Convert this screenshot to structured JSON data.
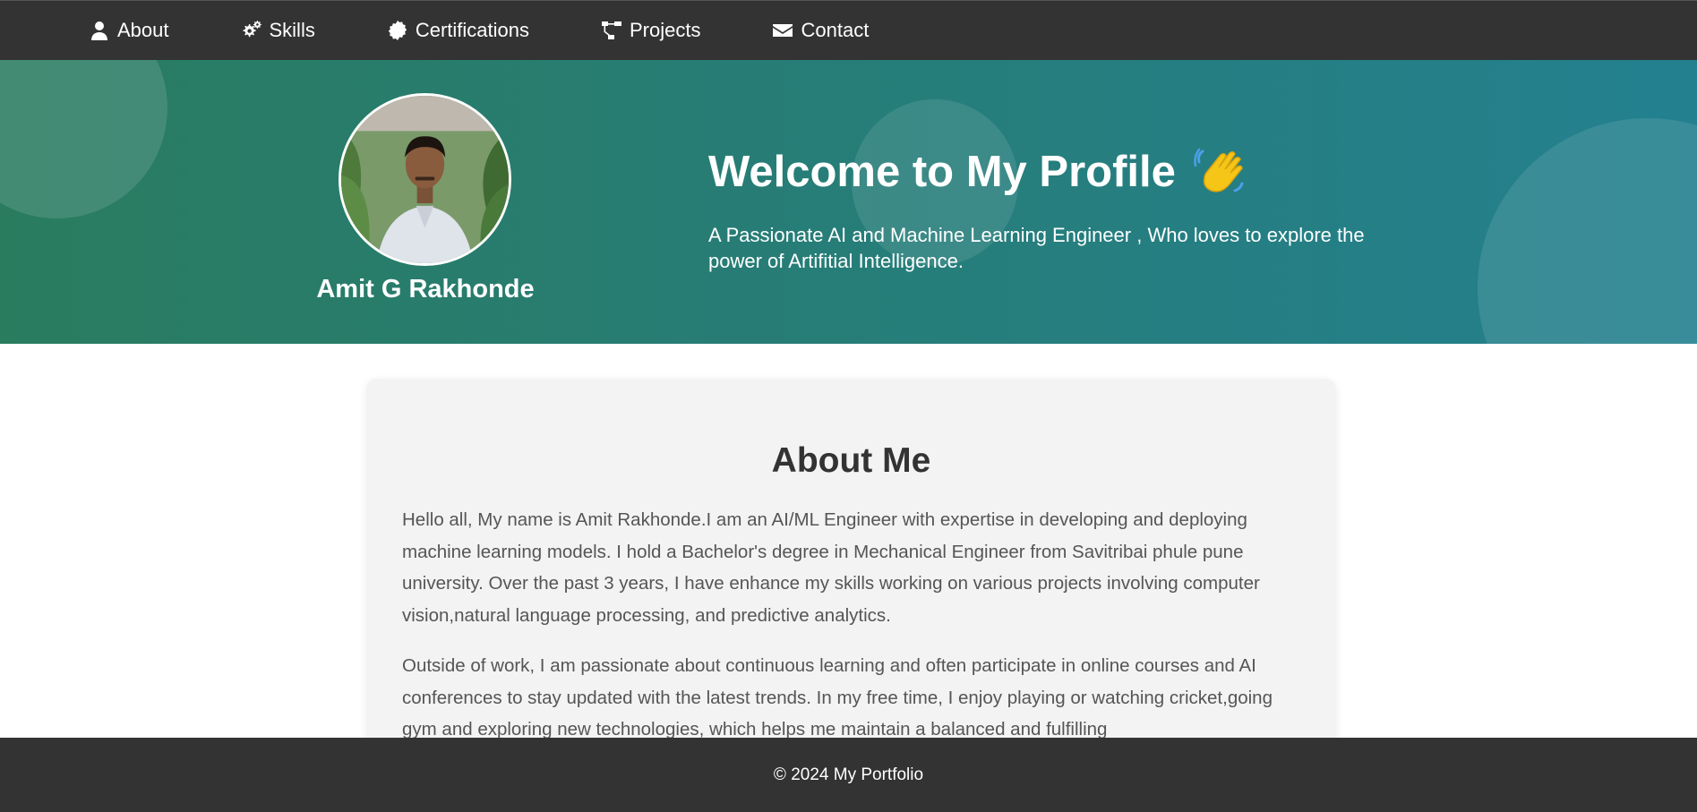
{
  "nav": {
    "items": [
      {
        "label": "About",
        "icon": "user-icon"
      },
      {
        "label": "Skills",
        "icon": "cogs-icon"
      },
      {
        "label": "Certifications",
        "icon": "certificate-icon"
      },
      {
        "label": "Projects",
        "icon": "project-diagram-icon"
      },
      {
        "label": "Contact",
        "icon": "envelope-icon"
      }
    ]
  },
  "hero": {
    "name": "Amit G Rakhonde",
    "title": "Welcome to My Profile",
    "wave_icon": "waving-hand-icon",
    "subtitle": "A Passionate AI and Machine Learning Engineer , Who loves to explore the power of Artifitial Intelligence.",
    "gradient_start": "#2a7c5f",
    "gradient_end": "#23808f"
  },
  "about": {
    "title": "About Me",
    "paragraphs": [
      "Hello all, My name is Amit Rakhonde.I am an AI/ML Engineer with expertise in developing and deploying machine learning models. I hold a Bachelor's degree in Mechanical Engineer from Savitribai phule pune university. Over the past 3 years, I have enhance my skills working on various projects involving computer vision,natural language processing, and predictive analytics.",
      "Outside of work, I am passionate about continuous learning and often participate in online courses and AI conferences to stay updated with the latest trends. In my free time, I enjoy playing or watching cricket,going gym and exploring new technologies, which helps me maintain a balanced and fulfilling"
    ]
  },
  "footer": {
    "text": "© 2024 My Portfolio"
  },
  "colors": {
    "navbar_bg": "#333333",
    "card_bg": "#f3f3f3",
    "footer_bg": "#333333"
  }
}
